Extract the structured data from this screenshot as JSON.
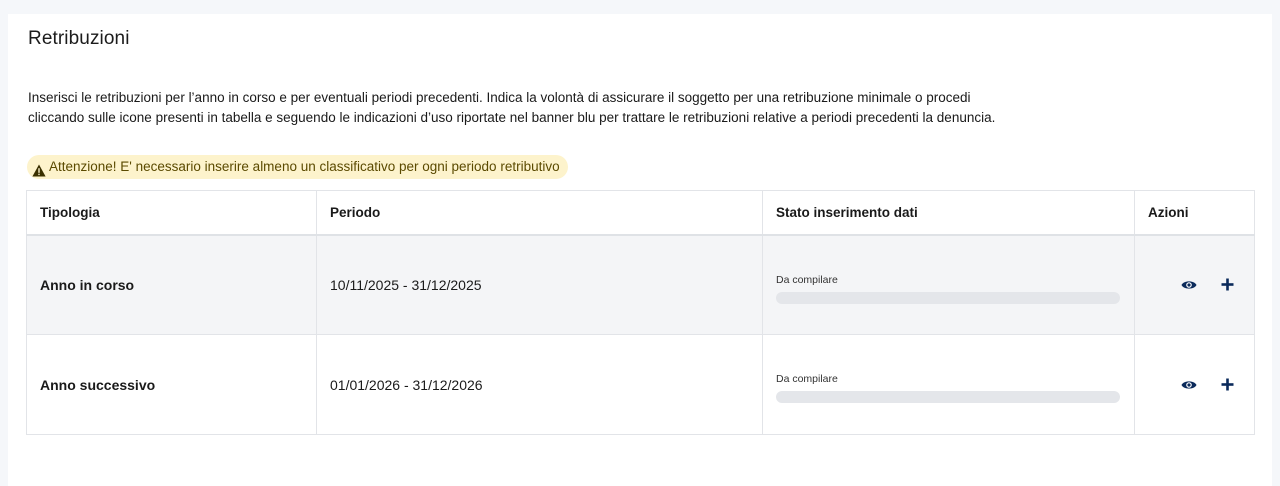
{
  "section": {
    "title": "Retribuzioni",
    "description_line1": "Inserisci le retribuzioni per l’anno in corso e per eventuali periodi precedenti. Indica la volontà di assicurare il soggetto per una retribuzione minimale o procedi",
    "description_line2": "cliccando sulle icone presenti in tabella e seguendo le indicazioni d’uso riportate nel banner blu per trattare le retribuzioni relative a periodi precedenti la denuncia.",
    "warning": "Attenzione! E' necessario inserire almeno un classificativo per ogni periodo retributivo"
  },
  "table": {
    "headers": {
      "tipologia": "Tipologia",
      "periodo": "Periodo",
      "stato": "Stato inserimento dati",
      "azioni": "Azioni"
    },
    "rows": [
      {
        "tipologia": "Anno in corso",
        "periodo": "10/11/2025 - 31/12/2025",
        "stato_label": "Da compilare",
        "progress": 0
      },
      {
        "tipologia": "Anno successivo",
        "periodo": "01/01/2026 - 31/12/2026",
        "stato_label": "Da compilare",
        "progress": 0
      }
    ]
  },
  "icons": {
    "warning": "warning-triangle-icon",
    "view": "eye-icon",
    "add": "plus-icon"
  },
  "colors": {
    "warning_bg": "#fdf3cc",
    "icon_navy": "#0b2a5b",
    "progress_track": "#e4e6ea"
  }
}
